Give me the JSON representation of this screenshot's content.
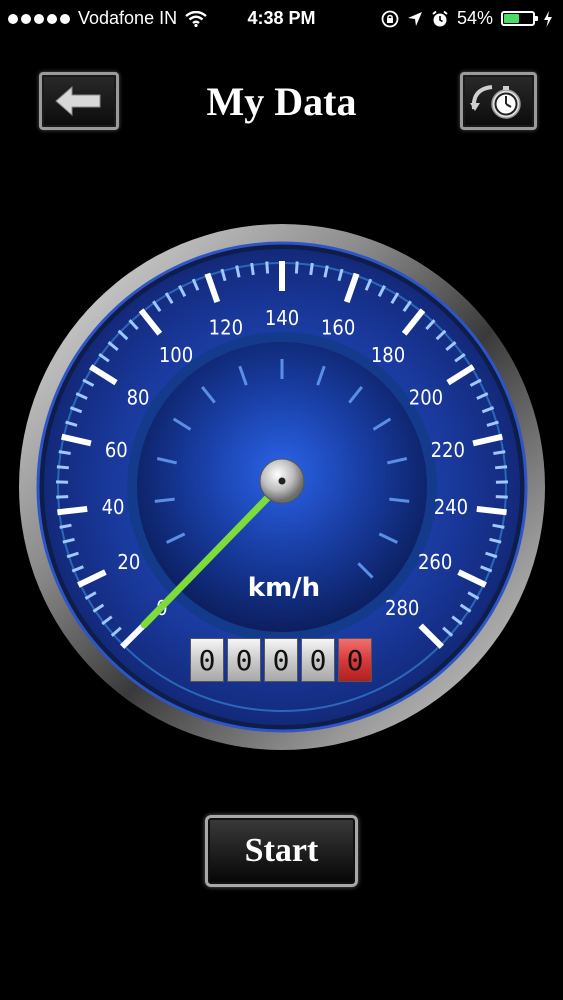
{
  "status_bar": {
    "carrier": "Vodafone IN",
    "time": "4:38 PM",
    "battery_percent": "54%",
    "battery_level": 0.54,
    "icons": [
      "signal-dots-icon",
      "wifi-icon",
      "rotation-lock-icon",
      "location-arrow-icon",
      "alarm-icon",
      "battery-icon",
      "charging-bolt-icon"
    ]
  },
  "header": {
    "title": "My Data",
    "back_icon": "arrow-left-icon",
    "history_icon": "stopwatch-history-icon"
  },
  "speedometer": {
    "unit": "km/h",
    "min": 0,
    "max": 280,
    "current_speed": 0,
    "tick_labels": [
      "0",
      "20",
      "40",
      "60",
      "80",
      "100",
      "120",
      "140",
      "160",
      "180",
      "200",
      "220",
      "240",
      "260",
      "280"
    ],
    "needle_color": "#7ddb3a",
    "dial_color": "#1d3fa8"
  },
  "odometer": {
    "digits": [
      "0",
      "0",
      "0",
      "0",
      "0"
    ]
  },
  "actions": {
    "start_label": "Start"
  }
}
